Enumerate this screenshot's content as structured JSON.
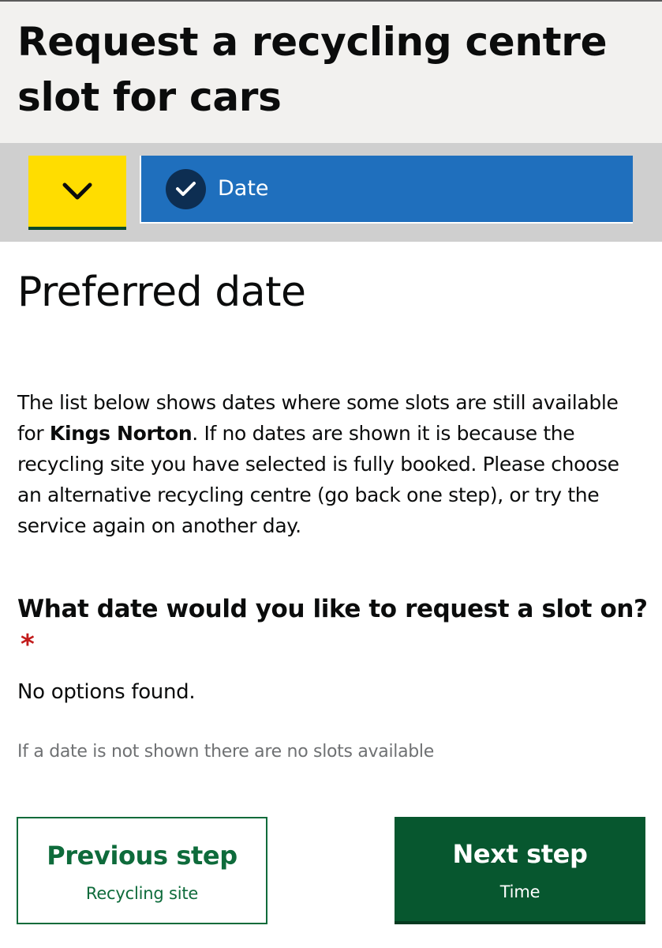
{
  "header": {
    "title": "Request a recycling centre slot for cars"
  },
  "step_bar": {
    "toggle_icon": "chevron-down-icon",
    "toggle_color": "#ffdd00",
    "current_step_label": "Date",
    "current_step_icon": "check-icon",
    "current_step_color": "#1f6fbd"
  },
  "page": {
    "title": "Preferred date",
    "intro_before": "The list below shows dates where some slots are still available for ",
    "intro_site": "Kings Norton",
    "intro_after": ". If no dates are shown it is because the recycling site you have selected is fully booked. Please choose an alternative recycling centre (go back one step), or try the service again on another day."
  },
  "question": {
    "label": "What date would you like to request a slot on?",
    "required_marker": "*",
    "no_options": "No options found.",
    "hint": "If a date is not shown there are no slots available"
  },
  "navigation": {
    "previous": {
      "label": "Previous step",
      "sub_label": "Recycling site"
    },
    "next": {
      "label": "Next step",
      "sub_label": "Time"
    },
    "accent_color": "#07572f"
  }
}
